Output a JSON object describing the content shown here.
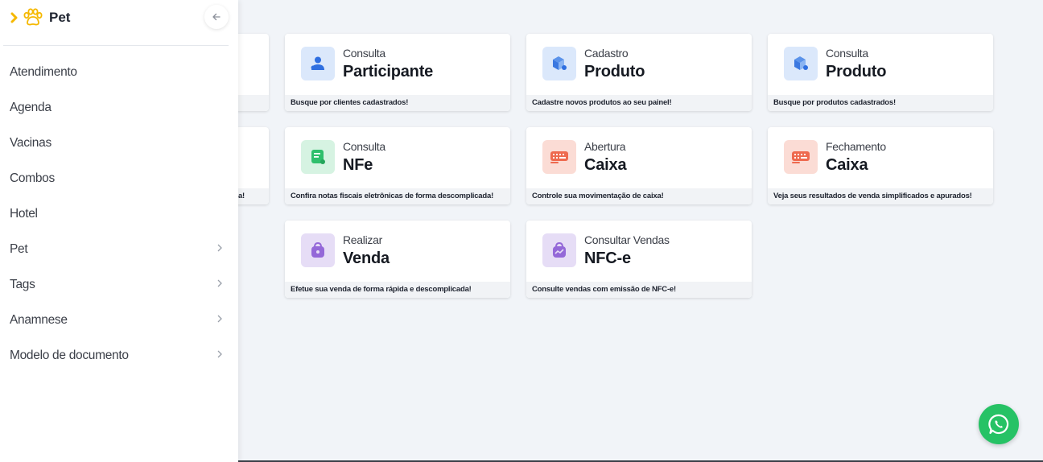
{
  "sidebar": {
    "title": "Pet",
    "items": [
      {
        "label": "Atendimento",
        "has_arrow": false
      },
      {
        "label": "Agenda",
        "has_arrow": false
      },
      {
        "label": "Vacinas",
        "has_arrow": false
      },
      {
        "label": "Combos",
        "has_arrow": false
      },
      {
        "label": "Hotel",
        "has_arrow": false
      },
      {
        "label": "Pet",
        "has_arrow": true
      },
      {
        "label": "Tags",
        "has_arrow": true
      },
      {
        "label": "Anamnese",
        "has_arrow": true
      },
      {
        "label": "Modelo de documento",
        "has_arrow": true
      }
    ]
  },
  "partial_cards": {
    "row1_footer": "",
    "row2_footer": "a!"
  },
  "cards": [
    {
      "small": "Consulta",
      "big": "Participante",
      "footer": "Busque por clientes cadastrados!",
      "icon": "user-icon",
      "color": "blue"
    },
    {
      "small": "Cadastro",
      "big": "Produto",
      "footer": "Cadastre novos produtos ao seu painel!",
      "icon": "box-icon",
      "color": "blue"
    },
    {
      "small": "Consulta",
      "big": "Produto",
      "footer": "Busque por produtos cadastrados!",
      "icon": "box-icon",
      "color": "blue"
    },
    {
      "small": "Consulta",
      "big": "NFe",
      "footer": "Confira notas fiscais eletrônicas de forma descomplicada!",
      "icon": "receipt-icon",
      "color": "green"
    },
    {
      "small": "Abertura",
      "big": "Caixa",
      "footer": "Controle sua movimentação de caixa!",
      "icon": "cash-register-icon",
      "color": "red"
    },
    {
      "small": "Fechamento",
      "big": "Caixa",
      "footer": "Veja seus resultados de venda simplificados e apurados!",
      "icon": "cash-register-icon",
      "color": "red"
    },
    {
      "small": "Realizar",
      "big": "Venda",
      "footer": "Efetue sua venda de forma rápida e descomplicada!",
      "icon": "shopping-bag-icon",
      "color": "purple"
    },
    {
      "small": "Consultar Vendas",
      "big": "NFC-e",
      "footer": "Consulte vendas com emissão de NFC-e!",
      "icon": "sales-bag-icon",
      "color": "purple"
    }
  ],
  "colors": {
    "accent_yellow": "#f5b800",
    "icon_blue": "#2f6fe0",
    "icon_green": "#2fbf6c",
    "icon_red": "#ee6a4f",
    "icon_purple": "#9468d8",
    "whatsapp": "#26c265"
  }
}
